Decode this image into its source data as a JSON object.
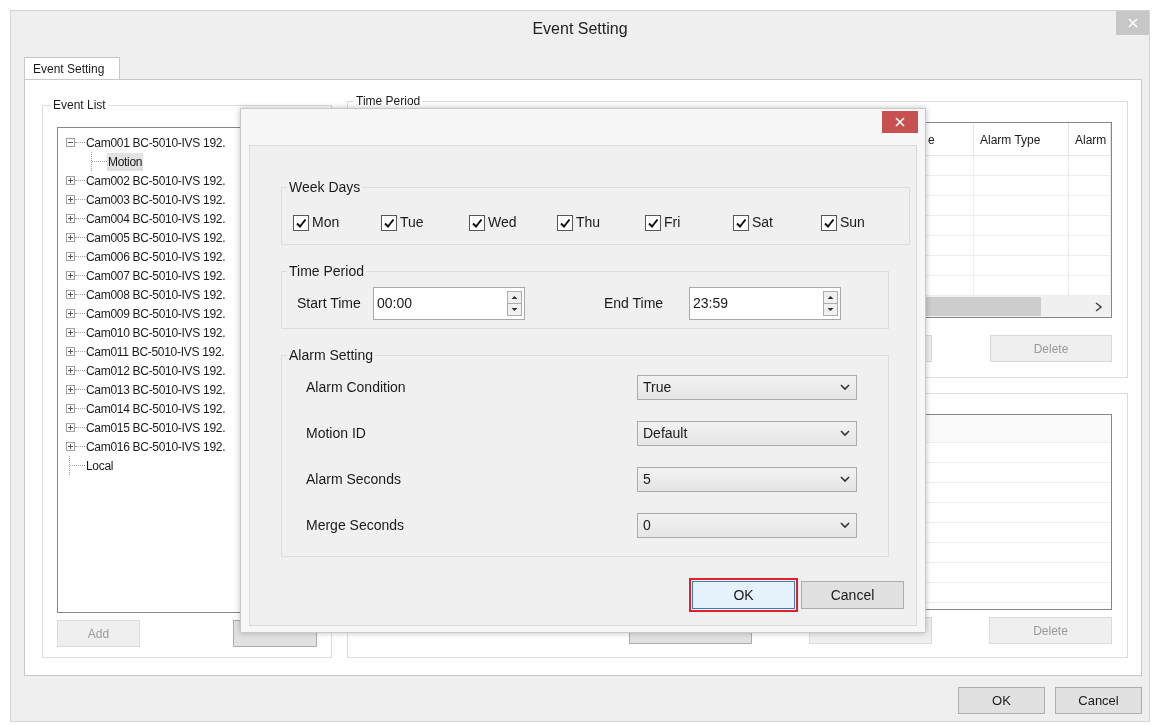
{
  "window": {
    "title": "Event Setting"
  },
  "tabs": [
    {
      "label": "Event Setting",
      "selected": true
    }
  ],
  "event_list": {
    "title": "Event List",
    "tree": [
      {
        "label": "Cam001 BC-5010-IVS 192.",
        "expanded": true,
        "selected": false,
        "children": [
          {
            "label": "Motion",
            "selected": true
          }
        ]
      },
      {
        "label": "Cam002 BC-5010-IVS 192.",
        "expanded": false,
        "selected": false
      },
      {
        "label": "Cam003 BC-5010-IVS 192.",
        "expanded": false,
        "selected": false
      },
      {
        "label": "Cam004 BC-5010-IVS 192.",
        "expanded": false,
        "selected": false
      },
      {
        "label": "Cam005 BC-5010-IVS 192.",
        "expanded": false,
        "selected": false
      },
      {
        "label": "Cam006 BC-5010-IVS 192.",
        "expanded": false,
        "selected": false
      },
      {
        "label": "Cam007 BC-5010-IVS 192.",
        "expanded": false,
        "selected": false
      },
      {
        "label": "Cam008 BC-5010-IVS 192.",
        "expanded": false,
        "selected": false
      },
      {
        "label": "Cam009 BC-5010-IVS 192.",
        "expanded": false,
        "selected": false
      },
      {
        "label": "Cam010 BC-5010-IVS 192.",
        "expanded": false,
        "selected": false
      },
      {
        "label": "Cam011 BC-5010-IVS 192.",
        "expanded": false,
        "selected": false
      },
      {
        "label": "Cam012 BC-5010-IVS 192.",
        "expanded": false,
        "selected": false
      },
      {
        "label": "Cam013 BC-5010-IVS 192.",
        "expanded": false,
        "selected": false
      },
      {
        "label": "Cam014 BC-5010-IVS 192.",
        "expanded": false,
        "selected": false
      },
      {
        "label": "Cam015 BC-5010-IVS 192.",
        "expanded": false,
        "selected": false
      },
      {
        "label": "Cam016 BC-5010-IVS 192.",
        "expanded": false,
        "selected": false
      },
      {
        "label": "Local",
        "selected": false
      }
    ],
    "buttons": [
      {
        "label": "Add",
        "disabled": true
      },
      {
        "disabled": false
      }
    ]
  },
  "time_period": {
    "title": "Time Period",
    "columns": [
      "e",
      "Alarm Type",
      "Alarm"
    ],
    "buttons": [
      {
        "disabled": true
      },
      {
        "label": "Delete",
        "disabled": true
      }
    ]
  },
  "alarm_list": {
    "buttons": [
      {
        "disabled": false
      },
      {
        "disabled": true
      },
      {
        "label": "Delete",
        "disabled": true
      }
    ]
  },
  "footer_buttons": [
    {
      "label": "OK"
    },
    {
      "label": "Cancel"
    }
  ],
  "dialog": {
    "week_days": {
      "title": "Week Days",
      "days": [
        {
          "label": "Mon",
          "checked": true
        },
        {
          "label": "Tue",
          "checked": true
        },
        {
          "label": "Wed",
          "checked": true
        },
        {
          "label": "Thu",
          "checked": true
        },
        {
          "label": "Fri",
          "checked": true
        },
        {
          "label": "Sat",
          "checked": true
        },
        {
          "label": "Sun",
          "checked": true
        }
      ]
    },
    "time_period": {
      "title": "Time Period",
      "start": {
        "label": "Start Time",
        "value": "00:00"
      },
      "end": {
        "label": "End Time",
        "value": "23:59"
      }
    },
    "alarm_setting": {
      "title": "Alarm Setting",
      "fields": [
        {
          "label": "Alarm Condition",
          "value": "True"
        },
        {
          "label": "Motion ID",
          "value": "Default"
        },
        {
          "label": "Alarm Seconds",
          "value": "5"
        },
        {
          "label": "Merge Seconds",
          "value": "0"
        }
      ]
    },
    "buttons": [
      {
        "label": "OK",
        "highlighted": true
      },
      {
        "label": "Cancel",
        "highlighted": false
      }
    ]
  }
}
